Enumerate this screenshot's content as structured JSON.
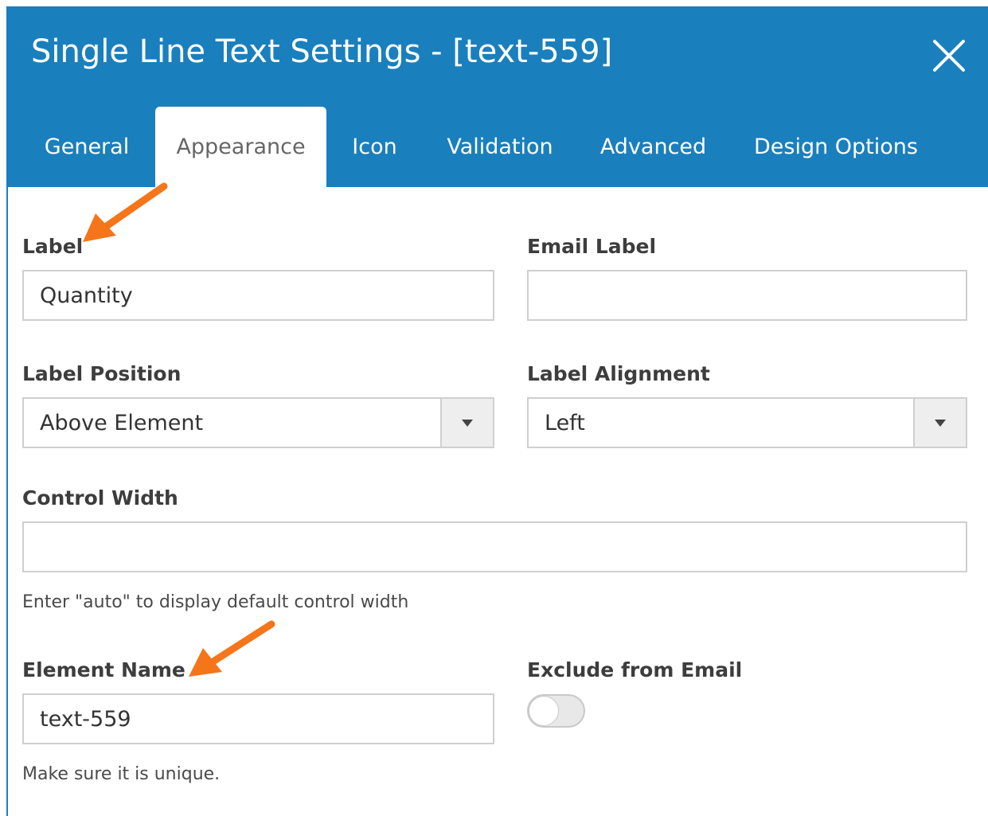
{
  "header": {
    "title": "Single Line Text Settings - [text-559]",
    "close_icon": "close-icon",
    "background_color": "#1a7fbd"
  },
  "tabs": [
    {
      "label": "General",
      "active": false
    },
    {
      "label": "Appearance",
      "active": true
    },
    {
      "label": "Icon",
      "active": false
    },
    {
      "label": "Validation",
      "active": false
    },
    {
      "label": "Advanced",
      "active": false
    },
    {
      "label": "Design Options",
      "active": false
    }
  ],
  "fields": {
    "label": {
      "label": "Label",
      "value": "Quantity"
    },
    "email_label": {
      "label": "Email Label",
      "value": ""
    },
    "label_position": {
      "label": "Label Position",
      "value": "Above Element"
    },
    "label_alignment": {
      "label": "Label Alignment",
      "value": "Left"
    },
    "control_width": {
      "label": "Control Width",
      "value": "",
      "help": "Enter \"auto\" to display default control width"
    },
    "element_name": {
      "label": "Element Name",
      "value": "text-559",
      "help": "Make sure it is unique."
    },
    "exclude_from_email": {
      "label": "Exclude from Email",
      "on": false
    }
  },
  "annotations": {
    "arrow_color": "#f5761a",
    "arrow_icon": "annotation-arrow-icon"
  }
}
